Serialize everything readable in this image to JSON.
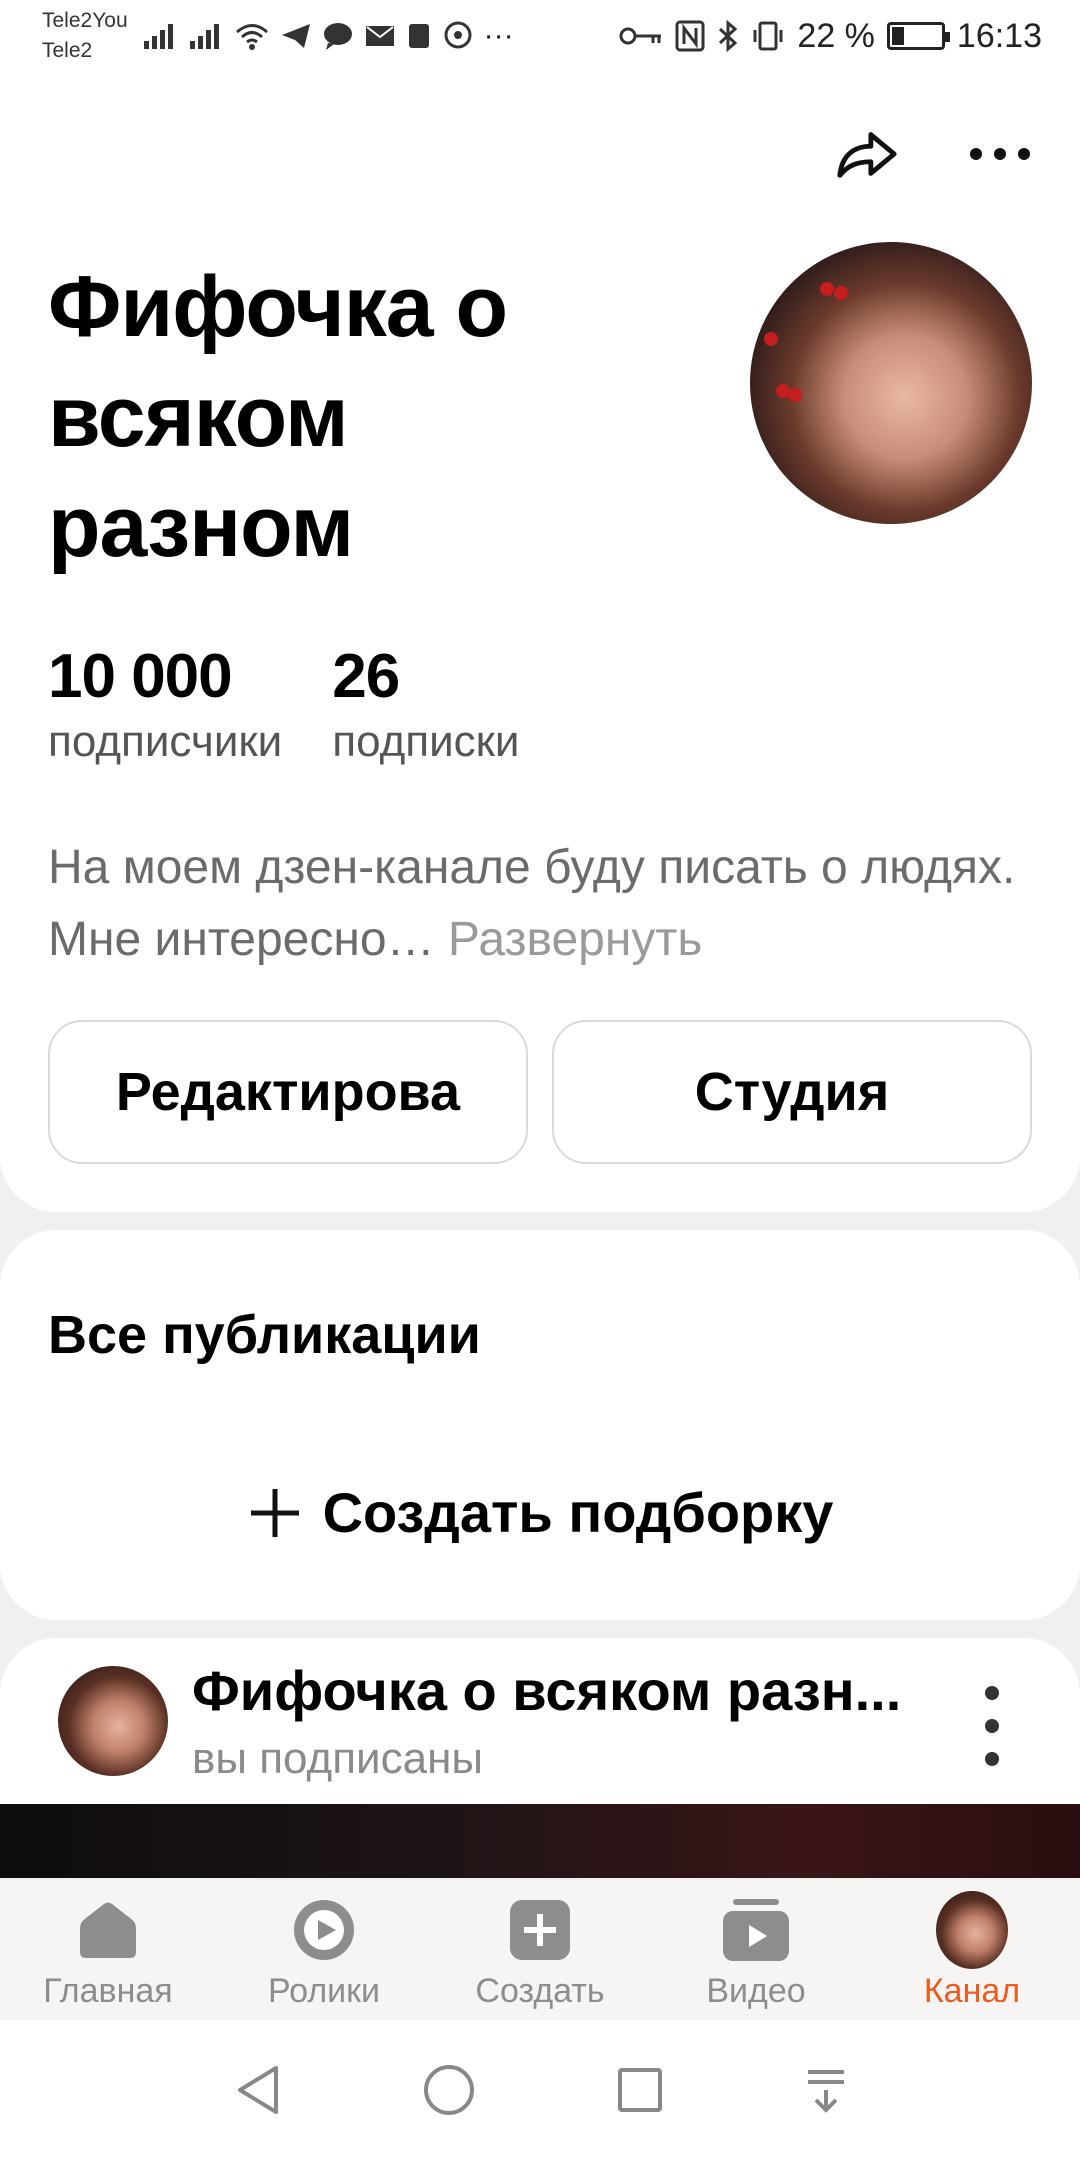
{
  "statusbar": {
    "carrier_1": "Tele2You",
    "carrier_2": "Tele2",
    "battery": "22 %",
    "time": "16:13"
  },
  "header": {
    "share_icon": "share-icon",
    "more_icon": "more-horizontal-icon"
  },
  "channel": {
    "title": "Фифочка о всяком разном",
    "subscribers_count": "10 000",
    "subscribers_label": "подписчики",
    "subscriptions_count": "26",
    "subscriptions_label": "подписки",
    "description": "На моем дзен-канале буду писать о людях. Мне интересно…",
    "expand_label": "Развернуть",
    "edit_button": "Редактирова",
    "studio_button": "Студия"
  },
  "publications": {
    "title": "Все публикации",
    "create_label": "Создать подборку"
  },
  "post": {
    "channel_name": "Фифочка о всяком разн...",
    "status": "вы подписаны"
  },
  "tabs": [
    {
      "label": "Главная",
      "icon": "home-icon"
    },
    {
      "label": "Ролики",
      "icon": "clips-icon"
    },
    {
      "label": "Создать",
      "icon": "create-icon"
    },
    {
      "label": "Видео",
      "icon": "video-icon"
    },
    {
      "label": "Канал",
      "icon": "channel-avatar",
      "active": true
    }
  ],
  "colors": {
    "accent": "#ee5a1f",
    "background": "#f1f0ee"
  }
}
